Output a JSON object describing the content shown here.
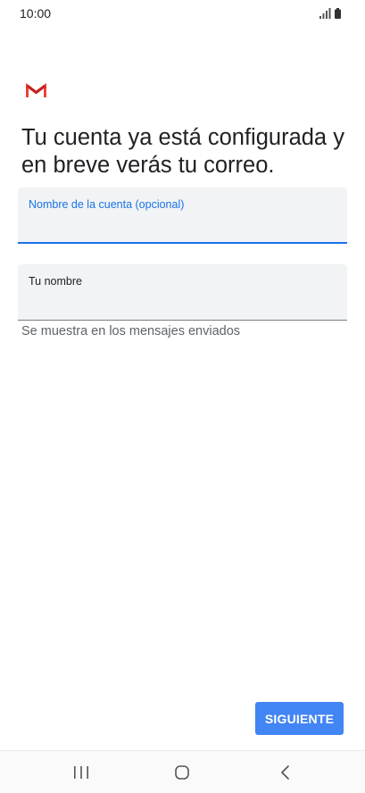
{
  "status_bar": {
    "time": "10:00",
    "icons": [
      "signal-icon",
      "battery-icon"
    ]
  },
  "logo": {
    "icon": "gmail-logo",
    "colors": [
      "#ea4335",
      "#c5221f"
    ]
  },
  "headline": "Tu cuenta ya está configurada y en breve verás tu correo.",
  "fields": {
    "account_name": {
      "label": "Nombre de la cuenta (opcional)",
      "value": "",
      "focused": true
    },
    "your_name": {
      "label": "Tu nombre",
      "value": "",
      "helper": "Se muestra en los mensajes enviados"
    }
  },
  "actions": {
    "next_label": "SIGUIENTE",
    "accent": "#4285f4"
  },
  "navigation": {
    "items": [
      "recents-icon",
      "home-icon",
      "back-icon"
    ]
  }
}
